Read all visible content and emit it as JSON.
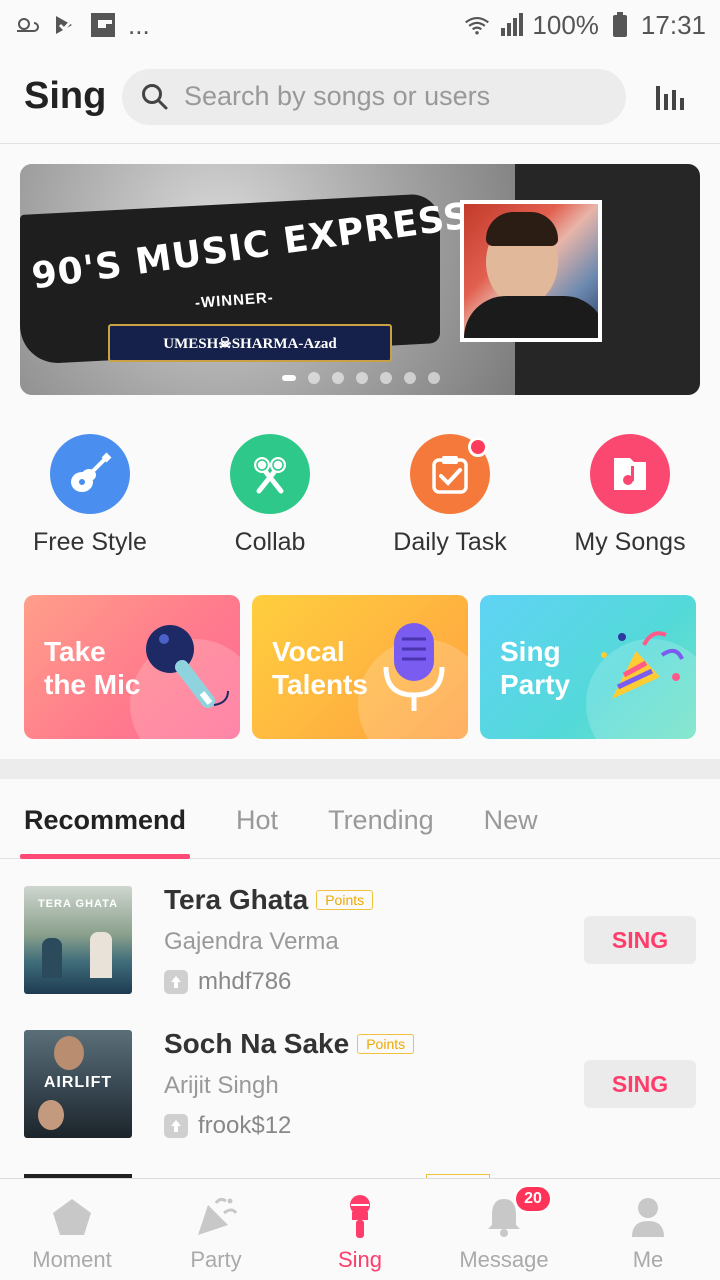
{
  "status_bar": {
    "left_icons": [
      "weather-icon",
      "check-icon",
      "flipboard-icon"
    ],
    "overflow": "...",
    "battery": "100%",
    "time": "17:31"
  },
  "header": {
    "title": "Sing",
    "search_placeholder": "Search by songs or users"
  },
  "banner": {
    "headline": "90'S MUSIC EXPRESS",
    "subtitle": "-WINNER-",
    "winner_name": "UMESH☠SHARMA-Azad",
    "page_count": 7,
    "active_index": 0
  },
  "quick_actions": [
    {
      "label": "Free Style",
      "icon": "guitar-icon",
      "color": "#4a8ff0"
    },
    {
      "label": "Collab",
      "icon": "microphones-icon",
      "color": "#2ec98a"
    },
    {
      "label": "Daily Task",
      "icon": "clipboard-check-icon",
      "color": "#f5793a",
      "notification_dot": true
    },
    {
      "label": "My Songs",
      "icon": "music-folder-icon",
      "color": "#fb4870"
    }
  ],
  "feature_cards": [
    {
      "label": "Take the Mic",
      "line1": "Take",
      "line2": "the Mic"
    },
    {
      "label": "Vocal Talents",
      "line1": "Vocal",
      "line2": "Talents"
    },
    {
      "label": "Sing Party",
      "line1": "Sing",
      "line2": "Party"
    }
  ],
  "tabs": [
    {
      "label": "Recommend",
      "active": true
    },
    {
      "label": "Hot",
      "active": false
    },
    {
      "label": "Trending",
      "active": false
    },
    {
      "label": "New",
      "active": false
    }
  ],
  "songs": [
    {
      "title": "Tera Ghata",
      "badge": "Points",
      "artist": "Gajendra Verma",
      "uploader": "mhdf786",
      "action": "SING",
      "cover_text": "TERA GHATA"
    },
    {
      "title": "Soch Na Sake",
      "badge": "Points",
      "artist": "Arijit Singh",
      "uploader": "frook$12",
      "action": "SING",
      "cover_text": "AIRLIFT"
    }
  ],
  "bottom_nav": [
    {
      "label": "Moment",
      "icon": "pentagon-icon",
      "active": false
    },
    {
      "label": "Party",
      "icon": "party-popper-icon",
      "active": false
    },
    {
      "label": "Sing",
      "icon": "microphone-icon",
      "active": true
    },
    {
      "label": "Message",
      "icon": "bell-icon",
      "active": false,
      "badge": "20"
    },
    {
      "label": "Me",
      "icon": "person-icon",
      "active": false
    }
  ],
  "colors": {
    "accent": "#ff3c6a",
    "points": "#f0a800",
    "tab_indicator": "#ff4a75"
  }
}
